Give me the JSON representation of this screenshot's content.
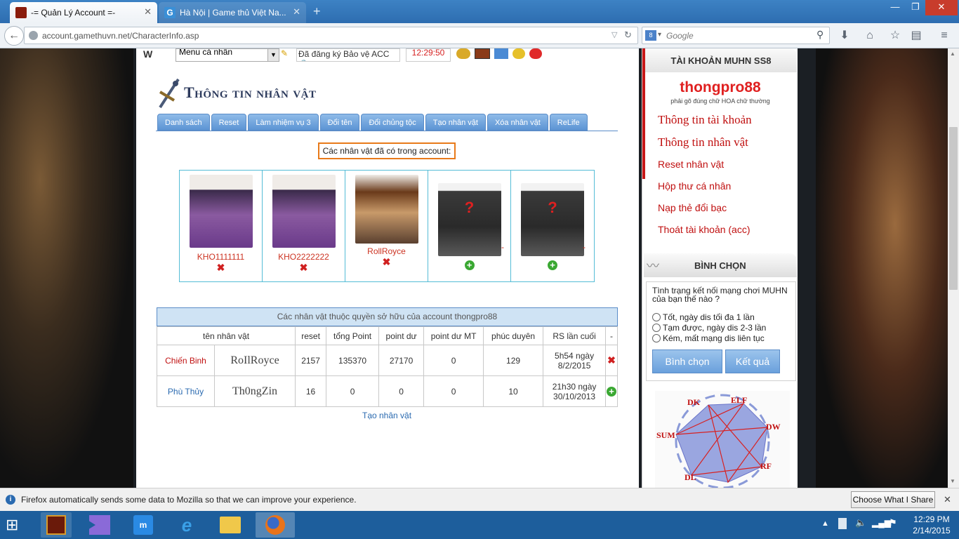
{
  "browser": {
    "tabs": [
      {
        "title": "-= Quản Lý Account =-",
        "active": true
      },
      {
        "title": "Hà Nội | Game thủ Việt Na...",
        "active": false
      }
    ],
    "new_tab_label": "+",
    "url": "account.gamethuvn.net/CharacterInfo.asp",
    "search_placeholder": "Google",
    "search_engine_badge": "8"
  },
  "topbar": {
    "menu_select": "Menu cá nhân",
    "status_text": "Đã đăng ký Bảo vệ ACC",
    "clock": "12:29:50"
  },
  "main": {
    "page_title": "Thông tin nhân vật",
    "tabs": [
      "Danh sách",
      "Reset",
      "Làm nhiệm vụ 3",
      "Đổi tên",
      "Đổi chủng tộc",
      "Tạo nhân vật",
      "Xóa nhân vật",
      "ReLife"
    ],
    "account_chars_label": "Các nhân vật đã có trong account:",
    "characters": [
      {
        "name": "KHO1111111",
        "action": "delete"
      },
      {
        "name": "KHO2222222",
        "action": "delete"
      },
      {
        "name": "RollRoyce",
        "action": "delete"
      },
      {
        "name": "-",
        "action": "add"
      },
      {
        "name": "-",
        "action": "add"
      }
    ],
    "table_caption": "Các nhân vật thuộc quyền sở hữu của account thongpro88",
    "table_headers": [
      "tên nhân vật",
      "reset",
      "tổng Point",
      "point dư",
      "point dư MT",
      "phúc duyên",
      "RS lần cuối",
      "-"
    ],
    "table_rows": [
      {
        "class": "Chiến Binh",
        "name": "RoIlRoyce",
        "reset": "2157",
        "total_point": "135370",
        "point_du": "27170",
        "point_du_mt": "0",
        "phuc_duyen": "129",
        "rs_time": "5h54 ngày",
        "rs_date": "8/2/2015",
        "action": "delete"
      },
      {
        "class": "Phù Thủy",
        "name": "Th0ngZin",
        "reset": "16",
        "total_point": "0",
        "point_du": "0",
        "point_du_mt": "0",
        "phuc_duyen": "10",
        "rs_time": "21h30 ngày",
        "rs_date": "30/10/2013",
        "action": "add"
      }
    ],
    "create_link": "Tạo nhân vật"
  },
  "sidebar": {
    "header": "TÀI KHOẢN MUHN SS8",
    "username": "thongpro88",
    "username_hint": "phải gõ đúng chữ HOA chữ thường",
    "menu": [
      "Thông tin tài khoản",
      "Thông tin nhân vật",
      "Reset nhân vật",
      "Hộp thư cá nhân",
      "Nạp thẻ đổi bạc",
      "Thoát tài khoản (acc)"
    ],
    "poll_header": "BÌNH CHỌN",
    "poll_question": "Tình trạng kết nối mạng chơi MUHN của bạn thế nào ?",
    "poll_options": [
      "Tốt, ngày dis tối đa 1 lần",
      "Tạm được, ngày dis 2-3 lần",
      "Kém, mất mạng dis liên tục"
    ],
    "vote_button": "Bình chọn",
    "result_button": "Kết quả",
    "diagram_labels": [
      "DK",
      "ELF",
      "DW",
      "RF",
      "DL",
      "SUM"
    ]
  },
  "notification": {
    "text": "Firefox automatically sends some data to Mozilla so that we can improve your experience.",
    "button": "Choose What I Share"
  },
  "taskbar": {
    "time": "12:29 PM",
    "date": "2/14/2015"
  }
}
